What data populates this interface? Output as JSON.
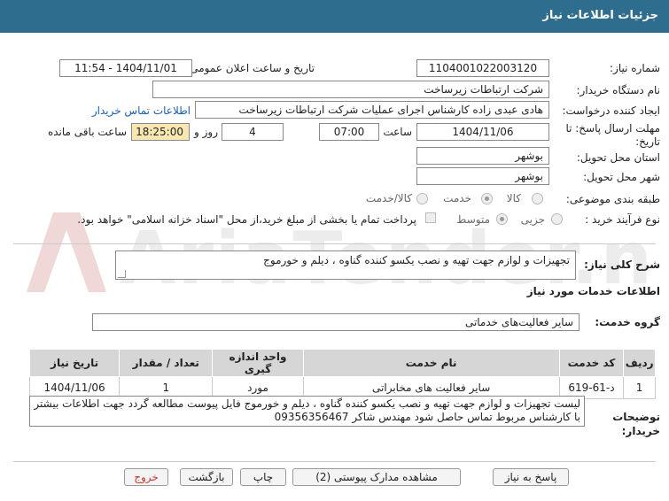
{
  "header": {
    "title": "جزئیات اطلاعات نیاز"
  },
  "watermark": {
    "text": "AriaTender.neT"
  },
  "fields": {
    "need_number_label": "شماره نیاز:",
    "need_number": "1104001022003120",
    "announce_label": "تاریخ و ساعت اعلان عمومی:",
    "announce_value": "1404/11/01 - 11:54",
    "buyer_org_label": "نام دستگاه خریدار:",
    "buyer_org": "شرکت ارتباطات زیرساخت",
    "creator_label": "ایجاد کننده درخواست:",
    "creator": "هادی عبدی زاده کارشناس اجرای عملیات شرکت ارتباطات زیرساخت",
    "contact_link": "اطلاعات تماس خریدار",
    "deadline_label": "مهلت ارسال پاسخ: تا تاریخ:",
    "deadline_date": "1404/11/06",
    "time_label": "ساعت",
    "deadline_time": "07:00",
    "days_value": "4",
    "days_label": "روز و",
    "remaining_time": "18:25:00",
    "remaining_label": "ساعت باقی مانده",
    "province_label": "استان محل تحویل:",
    "province": "بوشهر",
    "city_label": "شهر محل تحویل:",
    "city": "بوشهر",
    "category_label": "طبقه بندی موضوعی:",
    "category_options": [
      "کالا",
      "خدمت",
      "کالا/خدمت"
    ],
    "purchase_type_label": "نوع فرآیند خرید :",
    "purchase_options": [
      "جزیی",
      "متوسط"
    ],
    "payment_note": "پرداخت تمام یا بخشی از مبلغ خرید،از محل \"اسناد خزانه اسلامی\" خواهد بود."
  },
  "summary": {
    "label": "شرح کلی نیاز:",
    "text": "تجهیزات و لوازم جهت تهیه و نصب یکسو کننده گناوه ، دیلم و خورموج"
  },
  "services": {
    "title": "اطلاعات خدمات مورد نیاز",
    "group_label": "گروه خدمت:",
    "group_value": "سایر فعالیت‌های خدماتی",
    "table": {
      "headers": [
        "ردیف",
        "کد خدمت",
        "نام خدمت",
        "واحد اندازه گیری",
        "تعداد / مقدار",
        "تاریخ نیاز"
      ],
      "rows": [
        [
          "1",
          "د-61-619",
          "سایر فعالیت های مخابراتی",
          "مورد",
          "1",
          "1404/11/06"
        ]
      ]
    }
  },
  "buyer_notes": {
    "label": "توضیحات خریدار:",
    "text": "لیست  تجهیزات و لوازم جهت تهیه و نصب یکسو کننده گناوه ، دیلم و خورموج فایل پیوست مطالعه گردد جهت اطلاعات بیشتر با کارشناس مربوط تماس حاصل شود مهندس شاکر 09356356467"
  },
  "buttons": {
    "reply": "پاسخ به نیاز",
    "attachments": "مشاهده مدارک پیوستی (2)",
    "print": "چاپ",
    "back": "بازگشت",
    "exit": "خروج"
  },
  "colors": {
    "header": "#2e6d8e",
    "highlight": "#f8e7b0",
    "exit_text": "#c0392b"
  }
}
